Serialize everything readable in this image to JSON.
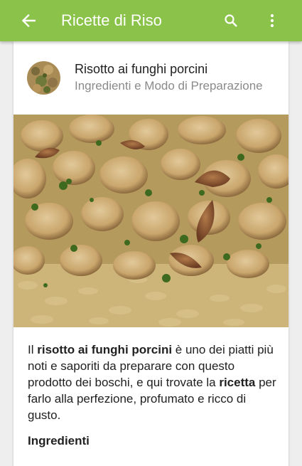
{
  "appbar": {
    "title": "Ricette di Riso",
    "back_icon": "arrow-back-icon",
    "search_icon": "search-icon",
    "more_icon": "more-vert-icon",
    "color": "#8bc34a"
  },
  "recipe": {
    "title": "Risotto ai funghi porcini",
    "subtitle": "Ingredienti e Modo di Preparazione",
    "intro": {
      "t1": "Il ",
      "b1": "risotto ai funghi porcini",
      "t2": " è uno dei piatti più noti e saporiti da preparare con questo prodotto dei boschi, e qui trovate la ",
      "b2": "ricetta",
      "t3": " per farlo alla perfezione, profumato e ricco di gusto."
    },
    "ingredients_heading": "Ingredienti"
  }
}
